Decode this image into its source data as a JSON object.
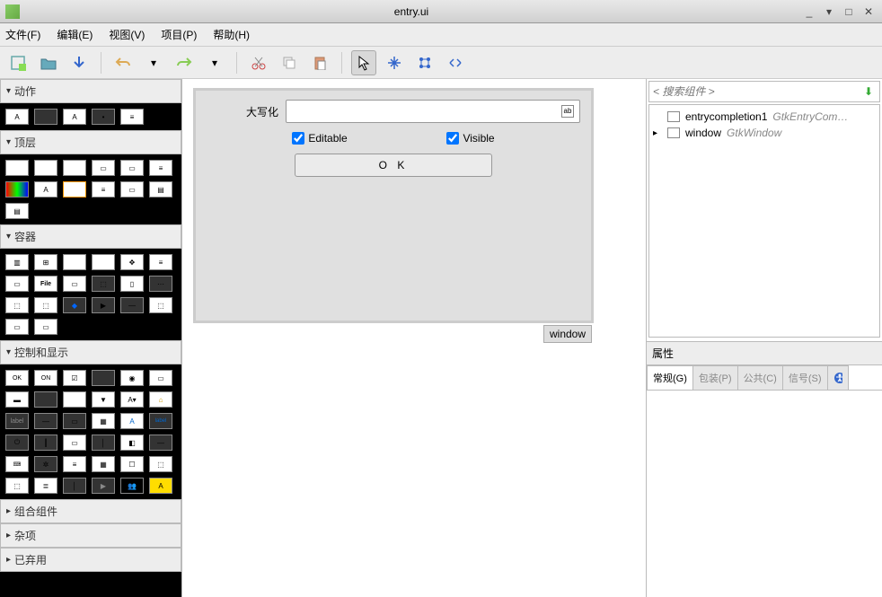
{
  "window": {
    "title": "entry.ui"
  },
  "menu": {
    "file": "文件(F)",
    "edit": "编辑(E)",
    "view": "视图(V)",
    "project": "项目(P)",
    "help": "帮助(H)"
  },
  "palette": {
    "actions": "动作",
    "toplevels": "顶层",
    "containers": "容器",
    "control_display": "控制和显示",
    "composite": "组合组件",
    "misc": "杂项",
    "deprecated": "已弃用"
  },
  "design": {
    "entry_label": "大写化",
    "editable": "Editable",
    "visible": "Visible",
    "ok": "O K",
    "window_name": "window"
  },
  "inspector": {
    "search_placeholder": "< 搜索组件 >",
    "items": [
      {
        "name": "entrycompletion1",
        "type": "GtkEntryCom…"
      },
      {
        "name": "window",
        "type": "GtkWindow"
      }
    ]
  },
  "props": {
    "title": "属性",
    "tabs": {
      "general": "常规(G)",
      "packing": "包装(P)",
      "common": "公共(C)",
      "signals": "信号(S)"
    }
  }
}
